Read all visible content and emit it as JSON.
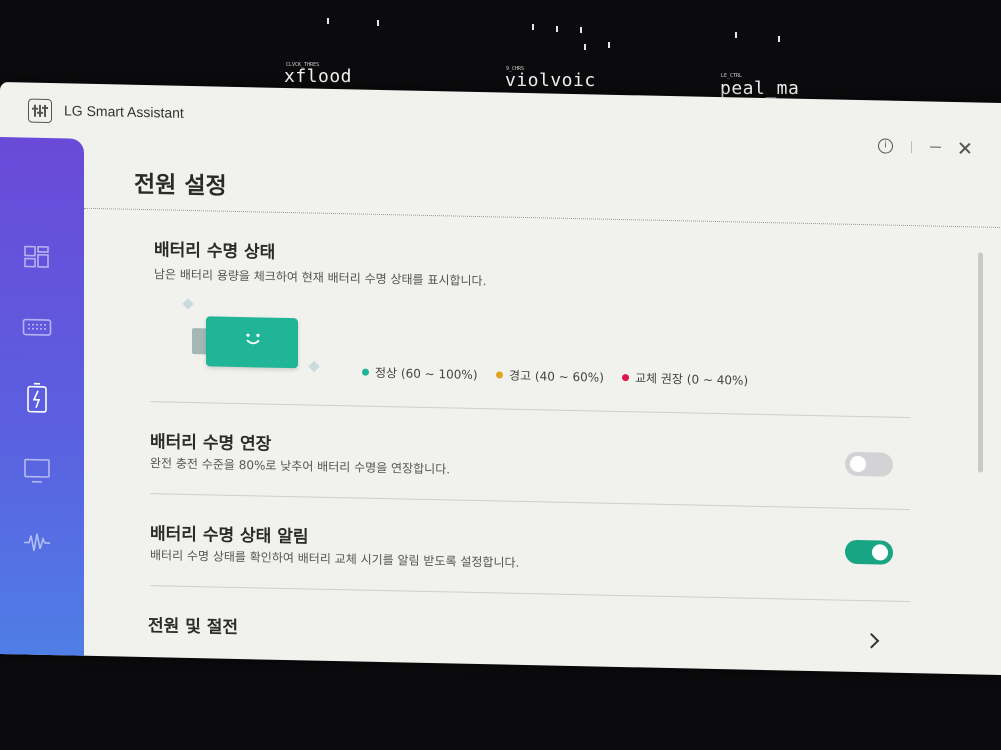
{
  "desktop": {
    "labels": [
      {
        "text": "xflood",
        "small": "CLVCK_THRES"
      },
      {
        "text": "violvoic",
        "small": "9_CHRS"
      },
      {
        "text": "peal_ma",
        "small": "LE_CTRL"
      }
    ]
  },
  "app": {
    "title": "LG Smart Assistant",
    "info_label": "i"
  },
  "sidebar": {
    "items": [
      {
        "icon": "dashboard-icon"
      },
      {
        "icon": "keyboard-icon"
      },
      {
        "icon": "battery-charging-icon",
        "active": true
      },
      {
        "icon": "monitor-icon"
      },
      {
        "icon": "audio-wave-icon"
      }
    ]
  },
  "page": {
    "title": "전원 설정"
  },
  "battery_health": {
    "title": "배터리 수명 상태",
    "desc": "남은 배터리 용량을 체크하여 현재 배터리 수명 상태를 표시합니다.",
    "status_level": "normal",
    "legend": [
      {
        "label": "정상 (60 ~ 100%)",
        "color": "#1fb596"
      },
      {
        "label": "경고 (40 ~ 60%)",
        "color": "#e3a31f"
      },
      {
        "label": "교체 권장 (0 ~ 40%)",
        "color": "#e0154a"
      }
    ]
  },
  "battery_extend": {
    "title": "배터리 수명 연장",
    "desc": "완전 충전 수준을 80%로 낮추어 배터리 수명을 연장합니다.",
    "enabled": false
  },
  "battery_alert": {
    "title": "배터리 수명 상태 알림",
    "desc": "배터리 수명 상태를 확인하여 배터리 교체 시기를 알림 받도록 설정합니다.",
    "enabled": true
  },
  "power_shutdown": {
    "title": "전원 및 절전"
  },
  "colors": {
    "accent": "#18a584",
    "sidebar_top": "#6a4ad8",
    "sidebar_bottom": "#4f7ee6"
  }
}
